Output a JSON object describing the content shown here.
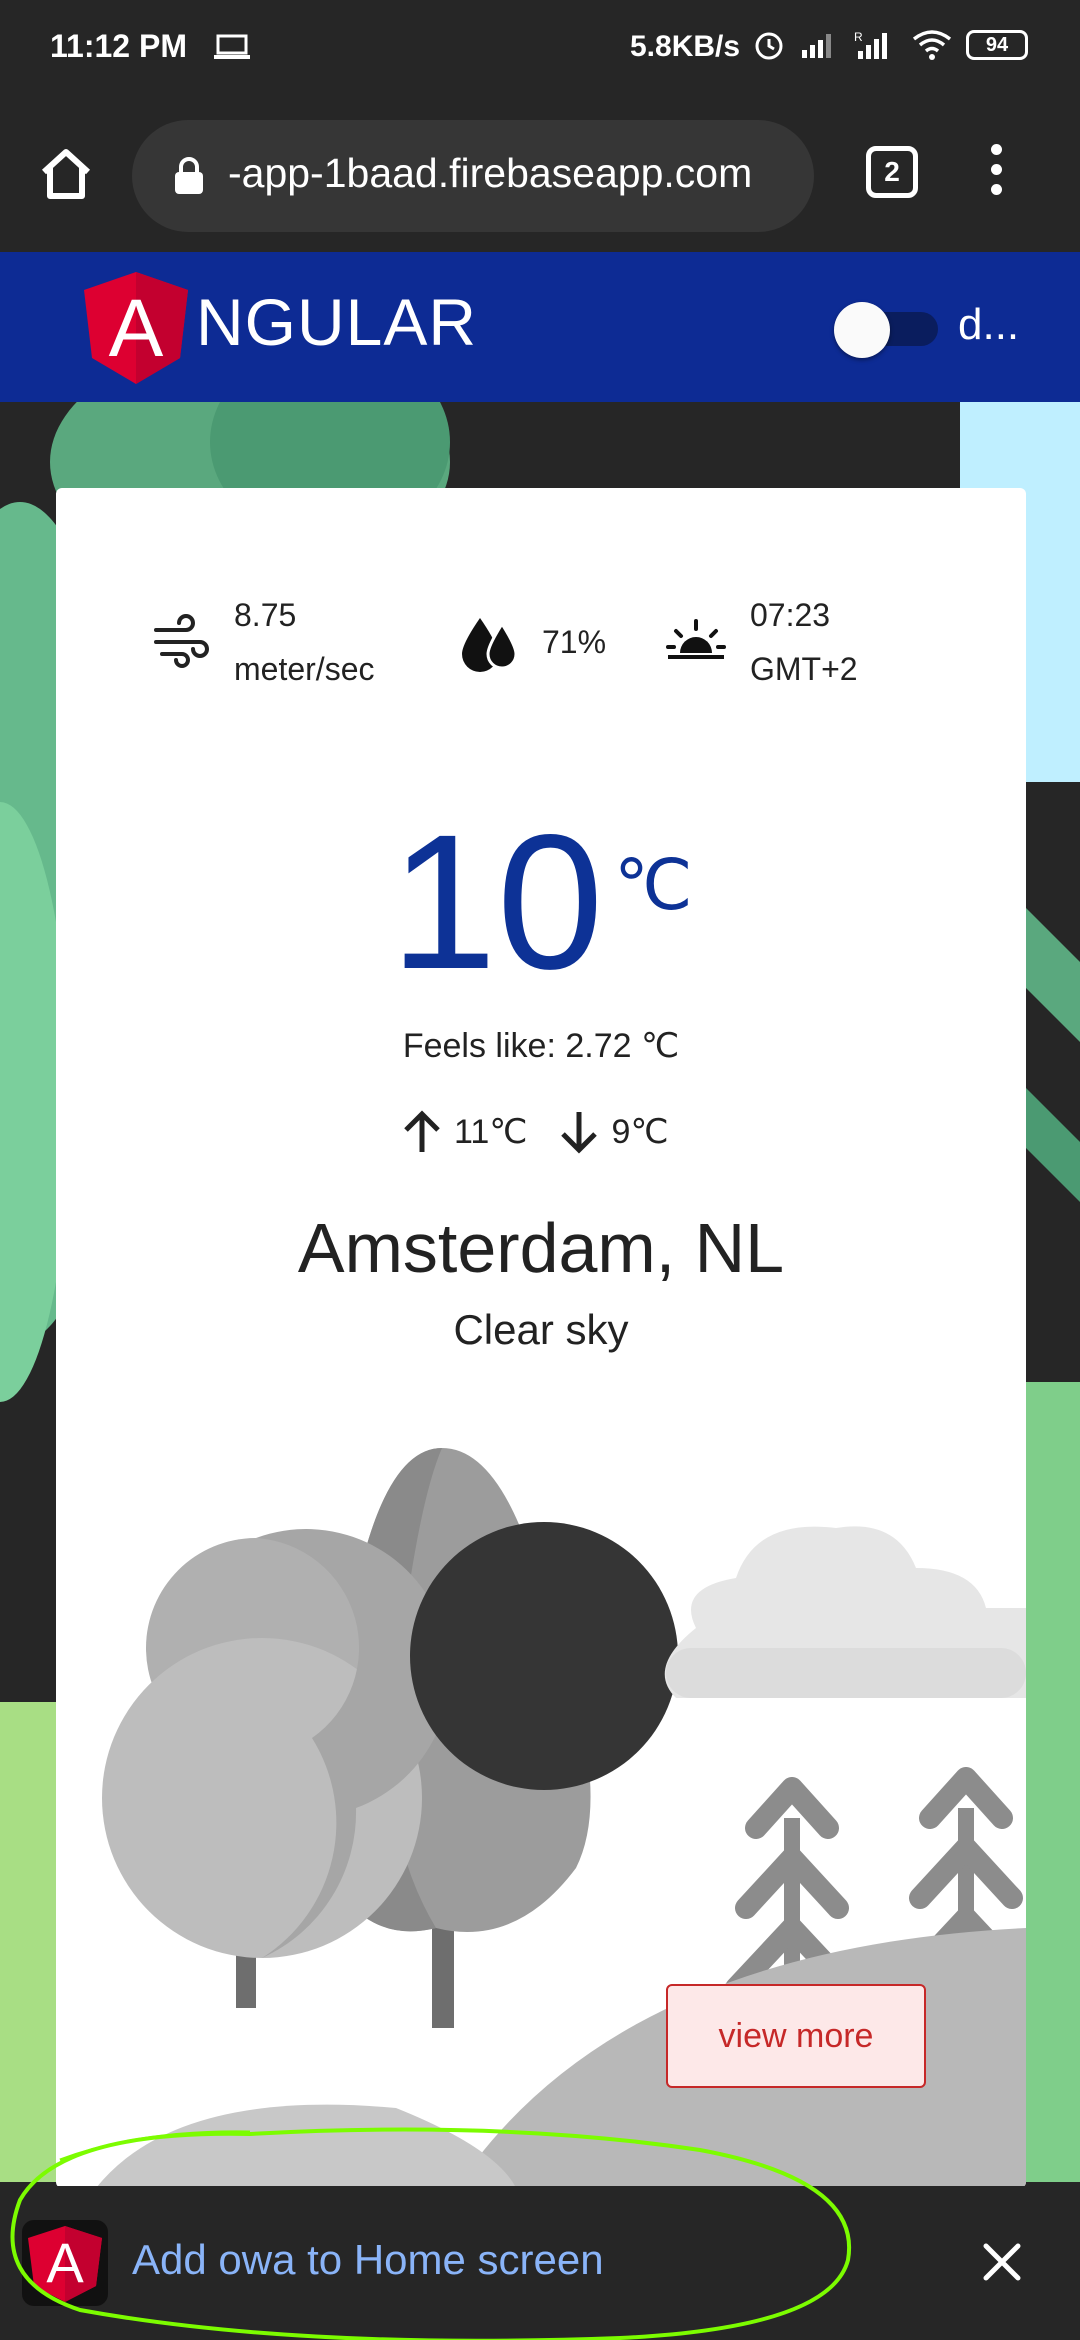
{
  "status_bar": {
    "time": "11:12 PM",
    "speed": "5.8KB/s",
    "battery": "94"
  },
  "browser": {
    "url": "-app-1baad.firebaseapp.com",
    "tab_count": "2"
  },
  "toolbar": {
    "brand": "NGULAR",
    "logo_letter": "A",
    "toggle_label": "d..."
  },
  "weather": {
    "wind_value": "8.75",
    "wind_unit": "meter/sec",
    "humidity": "71%",
    "sunrise_time": "07:23",
    "timezone": "GMT+2",
    "temperature": "10",
    "temp_unit": "℃",
    "feels_like": "Feels like: 2.72 ℃",
    "max": "11℃",
    "min": "9℃",
    "city": "Amsterdam, NL",
    "description": "Clear sky",
    "view_more": "view more"
  },
  "install_banner": {
    "icon_letter": "A",
    "text": "Add owa to Home screen"
  },
  "colors": {
    "brand_blue": "#0d2b94",
    "temp_blue": "#0d3296",
    "accent_red": "#c62828",
    "link_blue": "#8ab4f8",
    "annotation_green": "#7cfc00"
  }
}
